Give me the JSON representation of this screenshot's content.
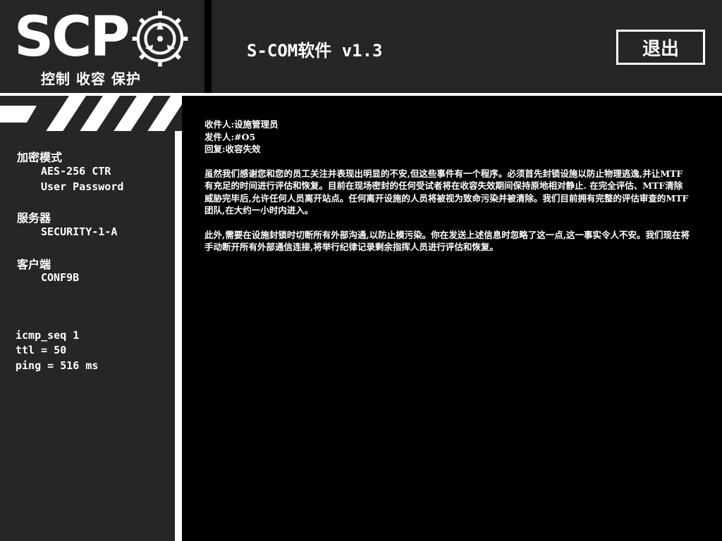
{
  "logo": {
    "wordmark": "SCP",
    "tagline": "控制 收容 保护",
    "emblem_icon": "scp-foundation-emblem-icon"
  },
  "header": {
    "title": "S-COM软件 v1.3",
    "logout_label": "退出"
  },
  "sidebar": {
    "encryption": {
      "heading": "加密模式",
      "values": [
        "AES-256 CTR",
        "User Password"
      ]
    },
    "server": {
      "heading": "服务器",
      "value": "SECURITY-1-A"
    },
    "client": {
      "heading": "客户端",
      "value": "CONF9B"
    },
    "stats": {
      "icmp_seq": "icmp_seq 1",
      "ttl": "ttl = 50",
      "ping": "ping = 516 ms"
    }
  },
  "message": {
    "recipient": "收件人:设施管理员",
    "sender": "发件人:#O5",
    "reply": "回复:收容失效",
    "paragraph_1": "虽然我们感谢您和您的员工关注并表现出明显的不安,但这些事件有一个程序。必须首先封锁设施以防止物理逃逸,并让MTF有充足的时间进行评估和恢复。目前在现场密封的任何受试者将在收容失效期间保持原地相对静止. 在完全评估、MTF清除威胁完毕后,允许任何人员离开站点。任何离开设施的人员将被视为致命污染并被清除。我们目前拥有完整的评估审查的MTF团队,在大约一小时内进入。",
    "paragraph_2": "此外,需要在设施封锁时切断所有外部沟通,以防止模污染。你在发送上述信息时忽略了这一点,这一事实令人不安。我们现在将手动断开所有外部通信连接,将举行纪律记录剩余指挥人员进行评估和恢复。"
  },
  "colors": {
    "panel": "#262626",
    "background": "#000000",
    "foreground": "#ffffff"
  }
}
